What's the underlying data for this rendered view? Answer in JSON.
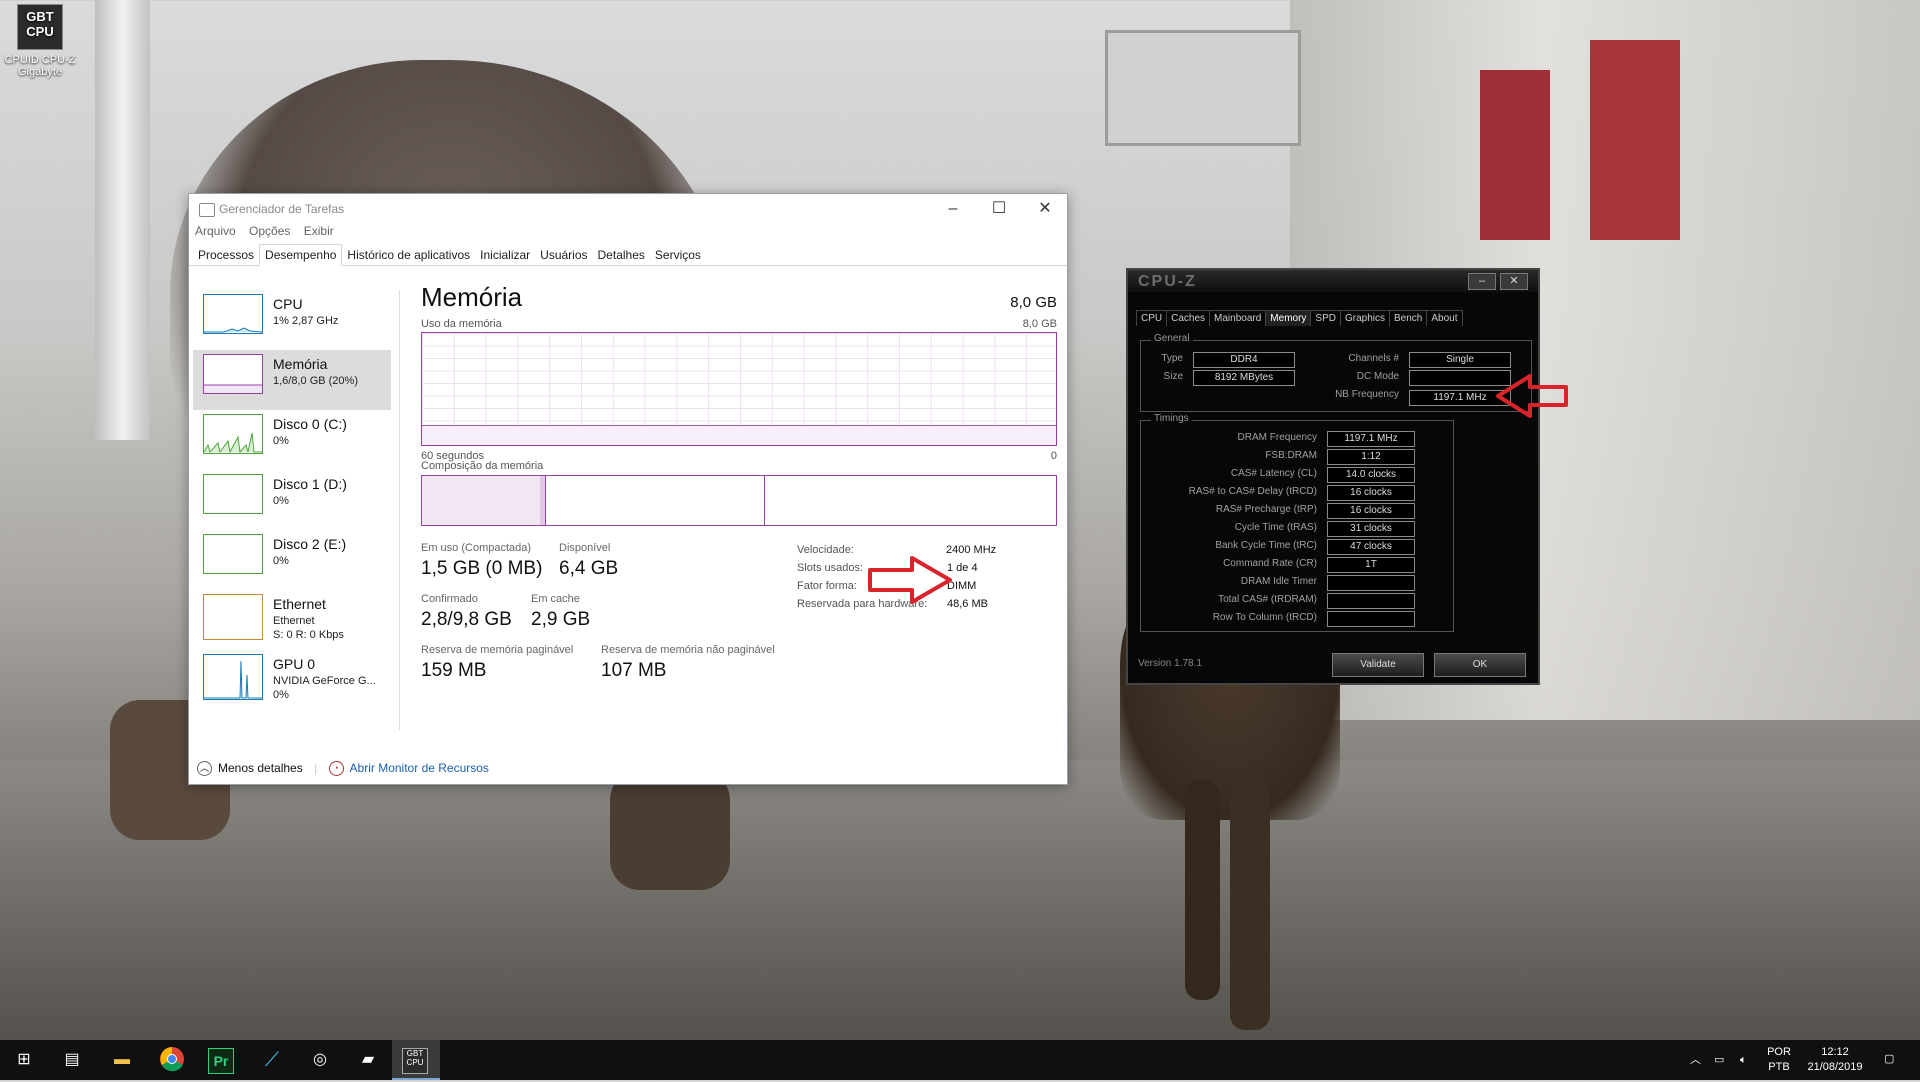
{
  "desktop": {
    "icon_text": "GBT CPU",
    "icon_label_line1": "CPUID CPU-Z",
    "icon_label_line2": "Gigabyte"
  },
  "taskmgr": {
    "title": "Gerenciador de Tarefas",
    "window_buttons": [
      "–",
      "☐",
      "✕"
    ],
    "menu": [
      "Arquivo",
      "Opções",
      "Exibir"
    ],
    "tabs": [
      "Processos",
      "Desempenho",
      "Histórico de aplicativos",
      "Inicializar",
      "Usuários",
      "Detalhes",
      "Serviços"
    ],
    "active_tab": "Desempenho",
    "sidebar": [
      {
        "title": "CPU",
        "sub1": "1% 2,87 GHz",
        "sub2": "",
        "color": "#1a7ab5"
      },
      {
        "title": "Memória",
        "sub1": "1,6/8,0 GB (20%)",
        "sub2": "",
        "color": "#9b3fa8"
      },
      {
        "title": "Disco 0 (C:)",
        "sub1": "0%",
        "sub2": "",
        "color": "#4da63a"
      },
      {
        "title": "Disco 1 (D:)",
        "sub1": "0%",
        "sub2": "",
        "color": "#4da63a"
      },
      {
        "title": "Disco 2 (E:)",
        "sub1": "0%",
        "sub2": "",
        "color": "#4da63a"
      },
      {
        "title": "Ethernet",
        "sub1": "Ethernet",
        "sub2": "S: 0 R: 0 Kbps",
        "color": "#c98a36"
      },
      {
        "title": "GPU 0",
        "sub1": "NVIDIA GeForce G...",
        "sub2": "0%",
        "color": "#1a7ab5"
      }
    ],
    "main": {
      "title": "Memória",
      "total": "8,0 GB",
      "usage_label": "Uso da memória",
      "usage_max": "8,0 GB",
      "axis_left": "60 segundos",
      "axis_right": "0",
      "composition_label": "Composição da memória",
      "stats": {
        "in_use_label": "Em uso (Compactada)",
        "in_use": "1,5 GB (0 MB)",
        "available_label": "Disponível",
        "available": "6,4 GB",
        "committed_label": "Confirmado",
        "committed": "2,8/9,8 GB",
        "cached_label": "Em cache",
        "cached": "2,9 GB",
        "paged_label": "Reserva de memória paginável",
        "paged": "159 MB",
        "nonpaged_label": "Reserva de memória não paginável",
        "nonpaged": "107 MB"
      },
      "details": [
        {
          "k": "Velocidade:",
          "v": "2400 MHz"
        },
        {
          "k": "Slots usados:",
          "v": "1 de 4"
        },
        {
          "k": "Fator forma:",
          "v": "DIMM"
        },
        {
          "k": "Reservada para hardware:",
          "v": "48,6 MB"
        }
      ]
    },
    "footer": {
      "less": "Menos detalhes",
      "monitor": "Abrir Monitor de Recursos"
    }
  },
  "cpuz": {
    "title": "CPU-Z",
    "tabs": [
      "CPU",
      "Caches",
      "Mainboard",
      "Memory",
      "SPD",
      "Graphics",
      "Bench",
      "About"
    ],
    "active_tab": "Memory",
    "general_label": "General",
    "type_label": "Type",
    "type": "DDR4",
    "size_label": "Size",
    "size": "8192 MBytes",
    "channels_label": "Channels #",
    "channels": "Single",
    "dcmode_label": "DC Mode",
    "dcmode": "",
    "nbfreq_label": "NB Frequency",
    "nbfreq": "1197.1 MHz",
    "timings_label": "Timings",
    "timings": [
      {
        "k": "DRAM Frequency",
        "v": "1197.1 MHz"
      },
      {
        "k": "FSB:DRAM",
        "v": "1:12"
      },
      {
        "k": "CAS# Latency (CL)",
        "v": "14.0 clocks"
      },
      {
        "k": "RAS# to CAS# Delay (tRCD)",
        "v": "16 clocks"
      },
      {
        "k": "RAS# Precharge (tRP)",
        "v": "16 clocks"
      },
      {
        "k": "Cycle Time (tRAS)",
        "v": "31 clocks"
      },
      {
        "k": "Bank Cycle Time (tRC)",
        "v": "47 clocks"
      },
      {
        "k": "Command Rate (CR)",
        "v": "1T"
      },
      {
        "k": "DRAM Idle Timer",
        "v": ""
      },
      {
        "k": "Total CAS# (tRDRAM)",
        "v": ""
      },
      {
        "k": "Row To Column (tRCD)",
        "v": ""
      }
    ],
    "version": "Version 1.78.1",
    "validate": "Validate",
    "ok": "OK"
  },
  "taskbar": {
    "lang1": "POR",
    "lang2": "PTB",
    "time": "12:12",
    "date": "21/08/2019"
  },
  "colors": {
    "memory_accent": "#9b3fa8",
    "arrow": "#d9242b"
  }
}
